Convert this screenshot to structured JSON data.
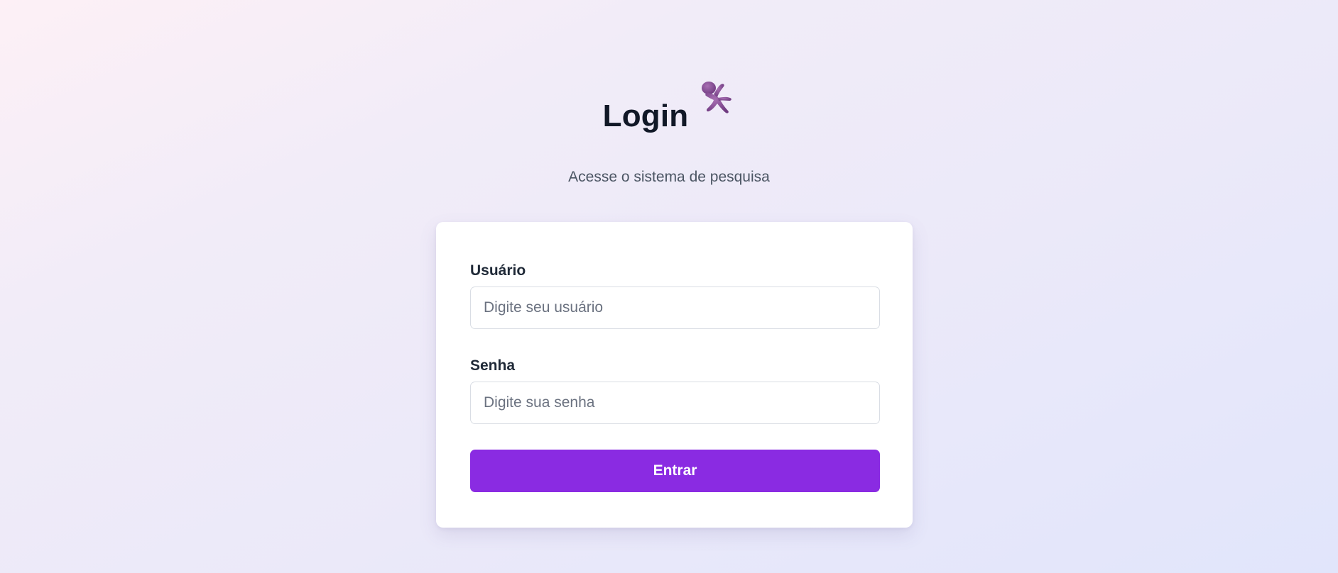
{
  "header": {
    "title": "Login",
    "subtitle": "Acesse o sistema de pesquisa",
    "mascot_icon": "purple-figure-icon"
  },
  "form": {
    "username": {
      "label": "Usuário",
      "value": "",
      "placeholder": "Digite seu usuário"
    },
    "password": {
      "label": "Senha",
      "value": "",
      "placeholder": "Digite sua senha"
    },
    "submit_label": "Entrar"
  },
  "colors": {
    "accent": "#8a2be2",
    "title": "#111827",
    "card": "#ffffff"
  }
}
